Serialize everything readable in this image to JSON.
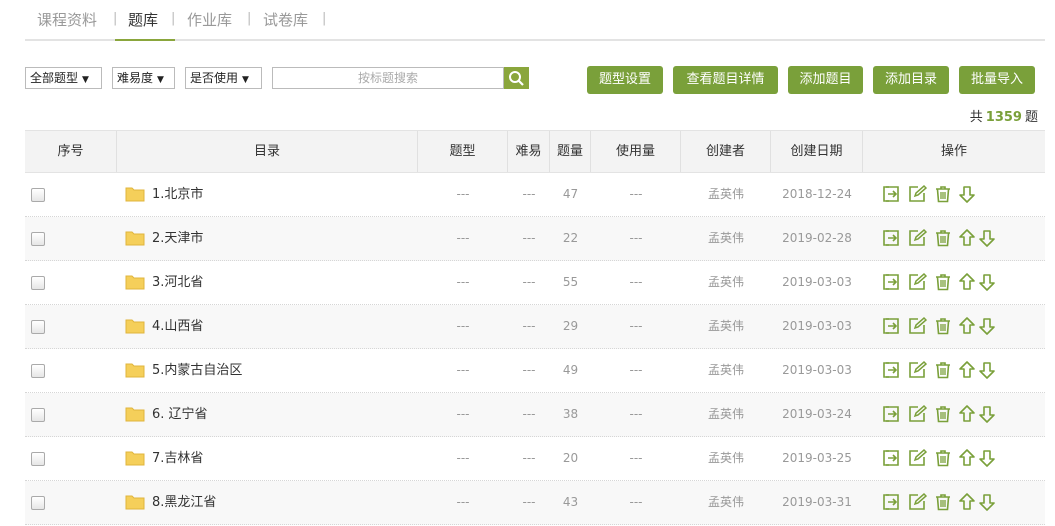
{
  "tabs": [
    {
      "label": "课程资料"
    },
    {
      "label": "题库"
    },
    {
      "label": "作业库"
    },
    {
      "label": "试卷库"
    }
  ],
  "separator": "|",
  "filters": {
    "type": "全部题型",
    "difficulty": "难易度",
    "usage": "是否使用"
  },
  "search": {
    "placeholder": "按标题搜索"
  },
  "actions": {
    "type_settings": "题型设置",
    "view_details": "查看题目详情",
    "add_question": "添加题目",
    "add_catalog": "添加目录",
    "batch_import": "批量导入"
  },
  "total": {
    "prefix": "共",
    "count": "1359",
    "suffix": "题"
  },
  "columns": {
    "index": "序号",
    "catalog": "目录",
    "type": "题型",
    "difficulty": "难易",
    "count": "题量",
    "usage": "使用量",
    "creator": "创建者",
    "date": "创建日期",
    "ops": "操作"
  },
  "rows": [
    {
      "name": "1.北京市",
      "type": "---",
      "difficulty": "---",
      "count": "47",
      "usage": "---",
      "creator": "孟英伟",
      "date": "2018-12-24"
    },
    {
      "name": "2.天津市",
      "type": "---",
      "difficulty": "---",
      "count": "22",
      "usage": "---",
      "creator": "孟英伟",
      "date": "2019-02-28"
    },
    {
      "name": "3.河北省",
      "type": "---",
      "difficulty": "---",
      "count": "55",
      "usage": "---",
      "creator": "孟英伟",
      "date": "2019-03-03"
    },
    {
      "name": "4.山西省",
      "type": "---",
      "difficulty": "---",
      "count": "29",
      "usage": "---",
      "creator": "孟英伟",
      "date": "2019-03-03"
    },
    {
      "name": "5.内蒙古自治区",
      "type": "---",
      "difficulty": "---",
      "count": "49",
      "usage": "---",
      "creator": "孟英伟",
      "date": "2019-03-03"
    },
    {
      "name": "6. 辽宁省",
      "type": "---",
      "difficulty": "---",
      "count": "38",
      "usage": "---",
      "creator": "孟英伟",
      "date": "2019-03-24"
    },
    {
      "name": "7.吉林省",
      "type": "---",
      "difficulty": "---",
      "count": "20",
      "usage": "---",
      "creator": "孟英伟",
      "date": "2019-03-25"
    },
    {
      "name": "8.黑龙江省",
      "type": "---",
      "difficulty": "---",
      "count": "43",
      "usage": "---",
      "creator": "孟英伟",
      "date": "2019-03-31"
    }
  ],
  "colors": {
    "accent": "#7aa03a",
    "folder": "#f5cf5a"
  },
  "icons": [
    "move-icon",
    "edit-icon",
    "delete-icon",
    "move-up-icon",
    "move-down-icon",
    "folder-icon",
    "search-icon"
  ]
}
